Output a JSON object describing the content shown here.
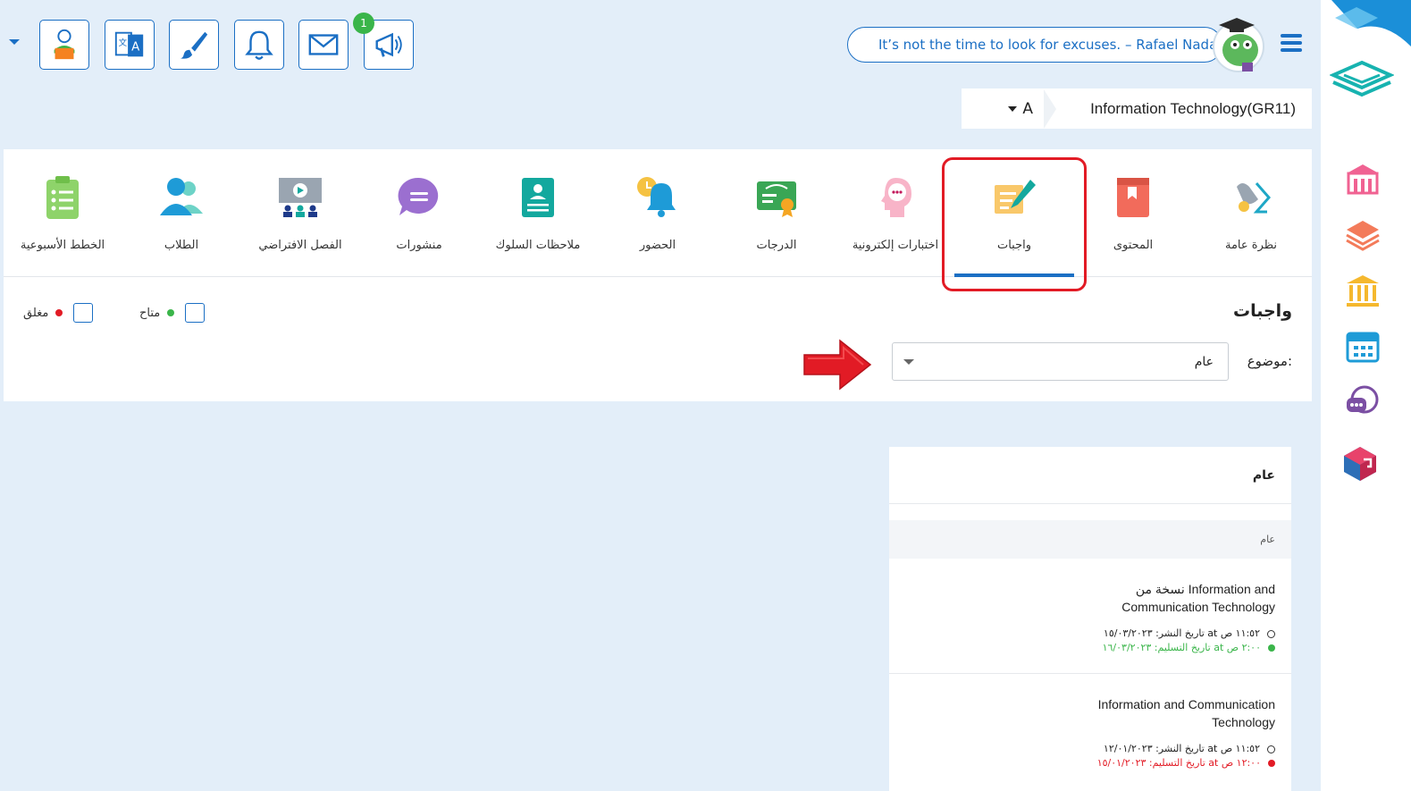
{
  "header": {
    "notifications_count": "1",
    "quote": "It’s not the time to look for excuses. – Rafael Nadal",
    "course_name": "Information Technology(GR11)",
    "section": "A"
  },
  "toolbar": [
    {
      "icon": "teacher-icon"
    },
    {
      "icon": "translate-icon"
    },
    {
      "icon": "brush-icon"
    },
    {
      "icon": "bell-icon"
    },
    {
      "icon": "mail-icon"
    },
    {
      "icon": "megaphone-icon"
    }
  ],
  "nav": {
    "overview": "نظرة عامة",
    "content": "المحتوى",
    "homework": "واجبات",
    "quizzes": "اختبارات إلكترونية",
    "grades": "الدرجات",
    "attendance": "الحضور",
    "behavior": "ملاحظات السلوك",
    "posts": "منشورات",
    "virtual_class": "الفصل الافتراضي",
    "students": "الطلاب",
    "weekly_plans": "الخطط الأسبوعية"
  },
  "page": {
    "title": "واجبات",
    "legend_available": "متاح",
    "legend_closed": "مغلق",
    "topic_label": "موضوع:",
    "topic_value": "عام"
  },
  "list": {
    "header": "عام",
    "group": "عام",
    "items": [
      {
        "title": "نسخة من Information and Communication Technology",
        "published": "تاريخ النشر: ١٥/٠٣/٢٠٢٣ at ١١:٥٢ ص",
        "due": "تاريخ التسليم: ١٦/٠٣/٢٠٢٣ at ٢:٠٠ ص",
        "status": "available"
      },
      {
        "title": "Information and Communication Technology",
        "published": "تاريخ النشر: ١٢/٠١/٢٠٢٣ at ١١:٥٢ ص",
        "due": "تاريخ التسليم: ١٥/٠١/٢٠٢٣ at ١٢:٠٠ ص",
        "status": "closed"
      }
    ]
  },
  "colors": {
    "primary": "#1b6fc4",
    "available": "#3ab54a",
    "closed": "#e21b25",
    "background": "#e3eef9"
  }
}
